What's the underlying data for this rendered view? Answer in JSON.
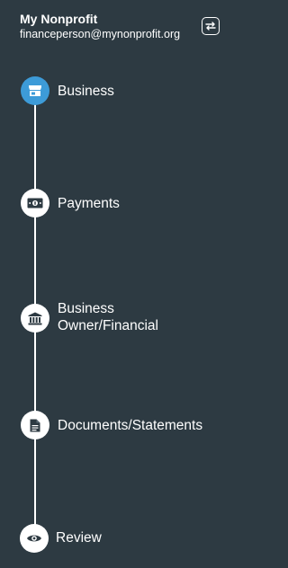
{
  "header": {
    "org_name": "My Nonprofit",
    "email": "financeperson@mynonprofit.org",
    "switch_icon": "switch-account-icon"
  },
  "colors": {
    "background": "#2d3a42",
    "active_step": "#3d9bd8",
    "inactive_step": "#ffffff",
    "icon_dark": "#2d3a42"
  },
  "steps": [
    {
      "label": "Business",
      "icon": "storefront-icon",
      "active": true
    },
    {
      "label": "Payments",
      "icon": "money-bill-icon",
      "active": false
    },
    {
      "label_line1": "Business",
      "label_line2": "Owner/Financial",
      "icon": "bank-icon",
      "active": false
    },
    {
      "label": "Documents/Statements",
      "icon": "document-icon",
      "active": false
    },
    {
      "label": "Review",
      "icon": "eye-icon",
      "active": false
    }
  ]
}
